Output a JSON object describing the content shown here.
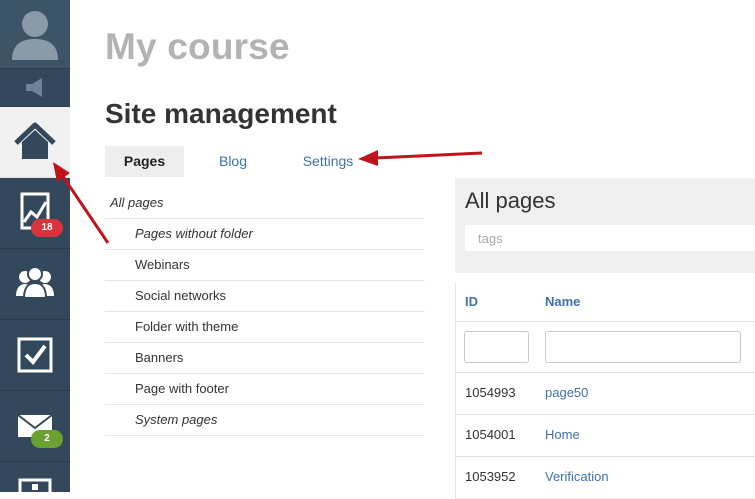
{
  "sidebar": {
    "badges": {
      "stats": "18",
      "mail": "2"
    }
  },
  "header": {
    "course_title": "My course",
    "section_title": "Site management"
  },
  "tabs": [
    {
      "label": "Pages",
      "active": true
    },
    {
      "label": "Blog",
      "active": false
    },
    {
      "label": "Settings",
      "active": false
    }
  ],
  "folders": [
    {
      "label": "All pages"
    },
    {
      "label": "Pages without folder"
    },
    {
      "label": "Webinars"
    },
    {
      "label": "Social networks"
    },
    {
      "label": "Folder with theme"
    },
    {
      "label": "Banners"
    },
    {
      "label": "Page with footer"
    },
    {
      "label": "System pages"
    }
  ],
  "panel": {
    "title": "All pages",
    "tags_placeholder": "tags"
  },
  "table": {
    "columns": [
      "ID",
      "Name"
    ],
    "rows": [
      {
        "id": "1054993",
        "name": "page50"
      },
      {
        "id": "1054001",
        "name": "Home"
      },
      {
        "id": "1053952",
        "name": "Verification"
      }
    ]
  },
  "colors": {
    "sidebar_bg": "#34485c",
    "link": "#3f72a8",
    "annotation_arrow": "#c0141b",
    "badge_red": "#d9343b",
    "badge_green": "#6aa131"
  }
}
